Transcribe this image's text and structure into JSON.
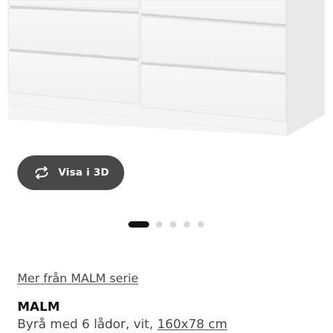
{
  "image": {
    "alt": "MALM Byrå med 6 lådor, vit"
  },
  "view_3d": {
    "label": "Visa i 3D",
    "icon": "rotate-3d-icon"
  },
  "carousel": {
    "total": 5,
    "active": 1
  },
  "series_link": "Mer från MALM serie",
  "product": {
    "name": "MALM",
    "description_prefix": "Byrå med 6 lådor, vit, ",
    "size": "160x78 cm"
  },
  "colors": {
    "button_bg": "#484848",
    "active_dot": "#111111",
    "inactive_dot": "#d6d6d6",
    "text": "#484848"
  }
}
